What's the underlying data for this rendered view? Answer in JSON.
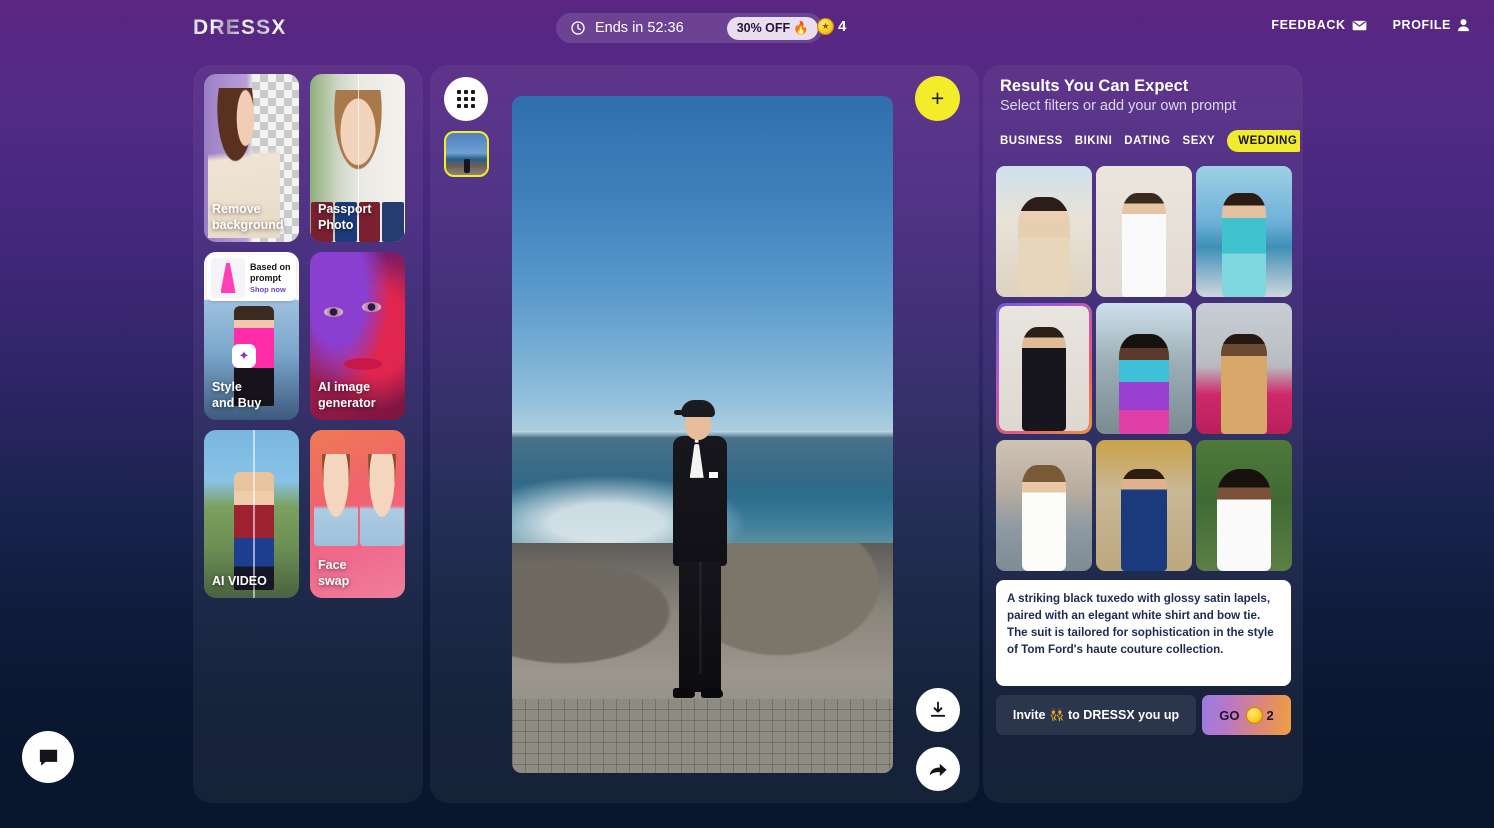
{
  "header": {
    "logo": "DRESSX",
    "promo": {
      "timer_label": "Ends in 52:36",
      "discount_badge": "30% OFF",
      "fire": "🔥"
    },
    "coins": {
      "icon": "coin-icon",
      "amount": "4"
    },
    "links": [
      {
        "label": "FEEDBACK",
        "icon": "envelope-icon"
      },
      {
        "label": "PROFILE",
        "icon": "person-icon"
      }
    ]
  },
  "left_panel": {
    "tools": [
      {
        "label": "Remove\nbackground",
        "line1": "Remove",
        "line2": "background",
        "name": "remove-background"
      },
      {
        "label": "Passport Photo",
        "line1": "Passport",
        "line2": "Photo",
        "name": "passport-photo"
      },
      {
        "label": "Style and Buy",
        "line1": "Style",
        "line2": "and Buy",
        "name": "style-and-buy",
        "promo_title_1": "Based on",
        "promo_title_2": "prompt",
        "promo_cta": "Shop now"
      },
      {
        "label": "AI image generator",
        "line1": "AI image",
        "line2": "generator",
        "name": "ai-image-generator"
      },
      {
        "label": "AI VIDEO",
        "line1": "AI VIDEO",
        "line2": "",
        "name": "ai-video"
      },
      {
        "label": "Face swap",
        "line1": "Face",
        "line2": "swap",
        "name": "face-swap"
      }
    ]
  },
  "center_panel": {
    "grid_button_icon": "grid-dots-icon",
    "add_button_label": "+",
    "download_icon": "download-icon",
    "share_icon": "share-icon",
    "thumbnail_selected": true
  },
  "right_panel": {
    "title": "Results You Can Expect",
    "subtitle": "Select filters or add your own prompt",
    "filters": [
      {
        "label": "BUSINESS",
        "active": false
      },
      {
        "label": "BIKINI",
        "active": false
      },
      {
        "label": "DATING",
        "active": false
      },
      {
        "label": "SEXY",
        "active": false
      },
      {
        "label": "WEDDING",
        "active": true
      }
    ],
    "filter_next_icon": "chevron-right-icon",
    "results": [
      {
        "alt": "bride in champagne gown",
        "selected": false
      },
      {
        "alt": "groom in white tuxedo",
        "selected": false
      },
      {
        "alt": "woman in teal gown by sea",
        "selected": false
      },
      {
        "alt": "man in black tuxedo",
        "selected": true
      },
      {
        "alt": "woman in iridescent gown",
        "selected": false
      },
      {
        "alt": "man in tan suit on red carpet",
        "selected": false
      },
      {
        "alt": "bride in white gown in venice",
        "selected": false
      },
      {
        "alt": "man in blue tuxedo",
        "selected": false
      },
      {
        "alt": "woman in white ruffled gown",
        "selected": false
      }
    ],
    "prompt": "A striking black tuxedo with glossy satin lapels, paired with an elegant white shirt and bow tie. The suit is tailored for sophistication in the style of Tom Ford's haute couture collection.",
    "invite_button": "Invite 👯 to DRESSX you up",
    "go_button": {
      "label": "GO",
      "cost": "2",
      "coin_icon": "coin-icon"
    }
  },
  "chat": {
    "icon": "chat-bubble-icon"
  },
  "colors": {
    "accent_yellow": "#f1ea2e",
    "bg_top": "#5a2682",
    "bg_bottom": "#09152c",
    "prompt_text": "#1d2a53"
  }
}
